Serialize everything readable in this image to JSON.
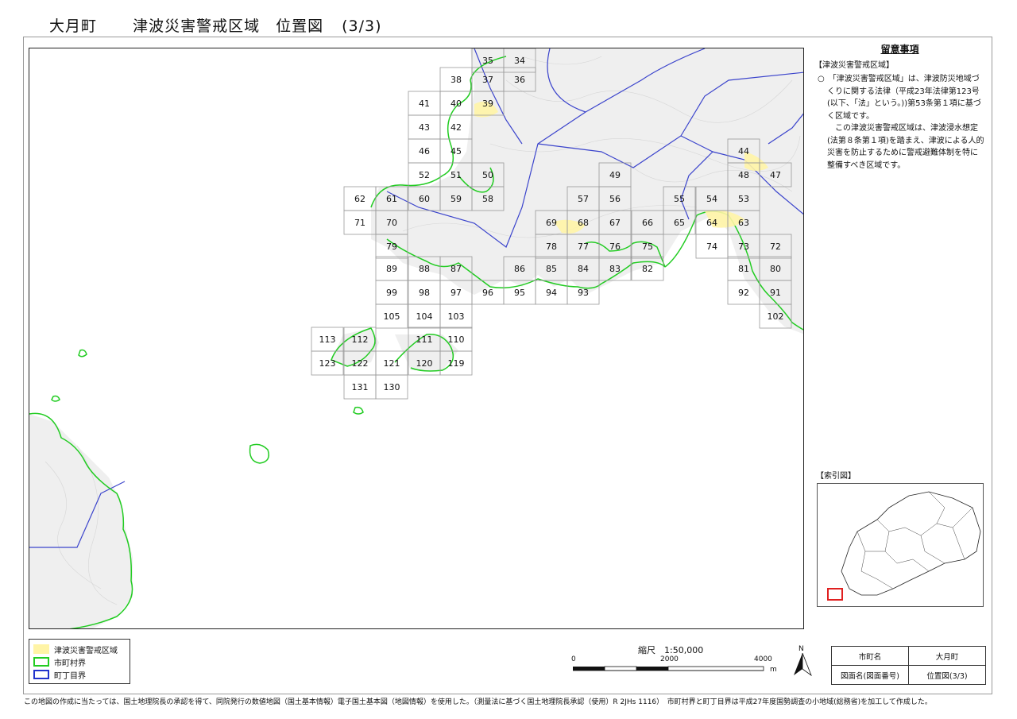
{
  "title": {
    "town": "大月町",
    "main": "津波災害警戒区域　位置図",
    "page": "(3/3)"
  },
  "notes": {
    "heading": "留意事項",
    "section": "【津波災害警戒区域】",
    "p1": "○　「津波災害警戒区域」は、津波防災地域づくりに関する法律（平成23年法律第123号(以下、「法」という。))第53条第１項に基づく区域です。",
    "p2": "この津波災害警戒区域は、津波浸水想定(法第８条第１項)を踏まえ、津波による人的災害を防止するために警戒避難体制を特に整備すべき区域です。"
  },
  "index_map": {
    "label": "【索引図】"
  },
  "legend": [
    {
      "label": "津波災害警戒区域",
      "color": "#fff4a6"
    },
    {
      "label": "市町村界",
      "color": "#22cc22"
    },
    {
      "label": "町丁目界",
      "color": "#2233cc"
    }
  ],
  "scale": {
    "title": "縮尺　1:50,000",
    "ticks": [
      "0",
      "2000",
      "4000"
    ],
    "unit": "m"
  },
  "north_label": "N",
  "info_table": {
    "town_key": "市町名",
    "town_value": "大月町",
    "sheet_key": "図面名(図面番号)",
    "sheet_value": "位置図(3/3)"
  },
  "footer": "この地図の作成に当たっては、国土地理院長の承認を得て、同院発行の数値地図（国土基本情報）電子国土基本図（地図情報）を使用した。（測量法に基づく国土地理院長承認（使用）R 2JHs 1116）　市町村界と町丁目界は平成27年度国勢調査の小地域(総務省)を加工して作成した。",
  "map": {
    "sheet_labels": [
      "35",
      "34",
      "38",
      "37",
      "36",
      "41",
      "40",
      "39",
      "43",
      "42",
      "46",
      "45",
      "52",
      "51",
      "50",
      "49",
      "62",
      "61",
      "60",
      "59",
      "58",
      "57",
      "56",
      "55",
      "54",
      "53",
      "71",
      "70",
      "69",
      "68",
      "67",
      "66",
      "65",
      "64",
      "63",
      "79",
      "78",
      "77",
      "76",
      "75",
      "74",
      "73",
      "72",
      "89",
      "88",
      "87",
      "86",
      "85",
      "84",
      "83",
      "82",
      "81",
      "80",
      "99",
      "98",
      "97",
      "96",
      "95",
      "94",
      "93",
      "92",
      "91",
      "105",
      "104",
      "103",
      "102",
      "113",
      "112",
      "111",
      "110",
      "123",
      "122",
      "121",
      "120",
      "119",
      "131",
      "130",
      "44",
      "48",
      "47"
    ],
    "colors": {
      "tsunami": "#fff4a6",
      "municipal": "#22cc22",
      "district": "#2233cc",
      "grid": "#999999"
    }
  }
}
